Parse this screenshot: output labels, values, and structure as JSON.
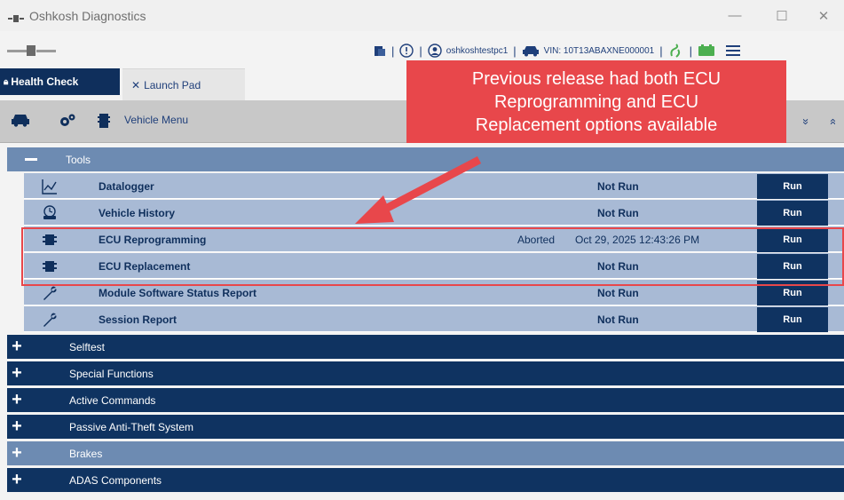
{
  "window": {
    "title": "Oshkosh Diagnostics",
    "controls": {
      "minimize": "—",
      "maximize": "☐",
      "close": "✕"
    }
  },
  "toolbar": {
    "user": "oshkoshtestpc1",
    "vin": "VIN: 10T13ABAXNE000001",
    "separator": "|"
  },
  "tabs": {
    "health_check": "Health Check",
    "launch_pad": "Launch Pad"
  },
  "menubar": {
    "vehicle_menu": "Vehicle Menu",
    "collapse_icon": "»",
    "expand_icon": "»"
  },
  "callout": {
    "text_line1": "Previous release had both ECU",
    "text_line2": "Reprogramming and ECU",
    "text_line3": "Replacement options available",
    "color": "#e8474b"
  },
  "tools_section": {
    "title": "Tools",
    "rows": [
      {
        "name": "Datalogger",
        "status": "Not Run",
        "run": "Run",
        "icon": "chart-icon"
      },
      {
        "name": "Vehicle History",
        "status": "Not Run",
        "run": "Run",
        "icon": "vehicle-history-icon"
      },
      {
        "name": "ECU Reprogramming",
        "status": "Aborted",
        "date": "Oct 29, 2025 12:43:26 PM",
        "run": "Run",
        "icon": "chip-icon"
      },
      {
        "name": "ECU Replacement",
        "status": "Not Run",
        "run": "Run",
        "icon": "chip-icon"
      },
      {
        "name": "Module Software Status Report",
        "status": "Not Run",
        "run": "Run",
        "icon": "wrench-icon"
      },
      {
        "name": "Session Report",
        "status": "Not Run",
        "run": "Run",
        "icon": "wrench-icon"
      }
    ]
  },
  "sections": [
    {
      "title": "Selftest"
    },
    {
      "title": "Special Functions"
    },
    {
      "title": "Active Commands"
    },
    {
      "title": "Passive Anti-Theft System"
    },
    {
      "title": "Brakes"
    },
    {
      "title": "ADAS Components"
    }
  ],
  "colors": {
    "navy": "#0f3361",
    "row_blue": "#a8bad5",
    "header_light": "#6d8bb2",
    "accent_red": "#e8474b"
  }
}
